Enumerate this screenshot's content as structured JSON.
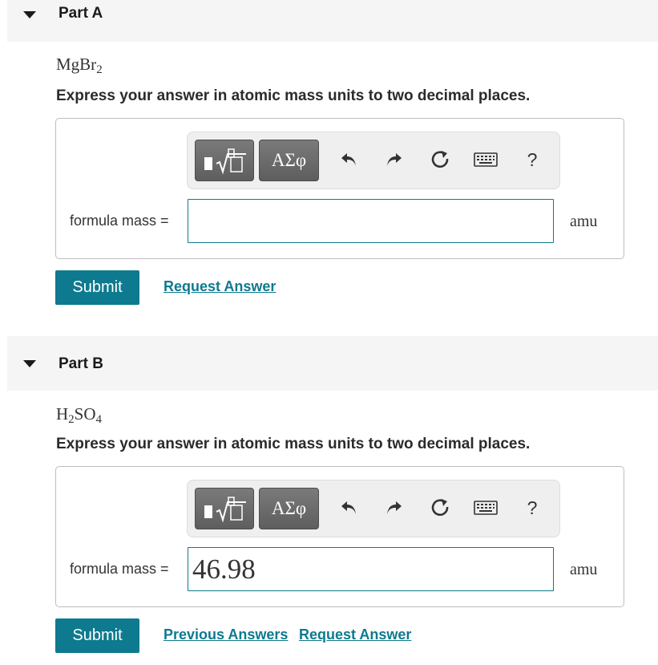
{
  "part_a": {
    "title": "Part A",
    "formula": {
      "base": "MgBr",
      "sub": "2"
    },
    "instruction": "Express your answer in atomic mass units to two decimal places.",
    "toolbar": {
      "templates_icon": "templates-sqrt-icon",
      "greek_label": "ΑΣφ",
      "undo_icon": "undo-icon",
      "redo_icon": "redo-icon",
      "reset_icon": "reset-icon",
      "keyboard_icon": "keyboard-icon",
      "help_label": "?"
    },
    "answer_label": "formula mass =",
    "answer_value": "",
    "unit": "amu",
    "submit_label": "Submit",
    "request_answer_label": "Request Answer"
  },
  "part_b": {
    "title": "Part B",
    "formula": {
      "p1": "H",
      "s1": "2",
      "p2": "SO",
      "s2": "4"
    },
    "instruction": "Express your answer in atomic mass units to two decimal places.",
    "toolbar": {
      "templates_icon": "templates-sqrt-icon",
      "greek_label": "ΑΣφ",
      "undo_icon": "undo-icon",
      "redo_icon": "redo-icon",
      "reset_icon": "reset-icon",
      "keyboard_icon": "keyboard-icon",
      "help_label": "?"
    },
    "answer_label": "formula mass =",
    "answer_value": "46.98",
    "unit": "amu",
    "submit_label": "Submit",
    "previous_answers_label": "Previous Answers",
    "request_answer_label": "Request Answer"
  },
  "colors": {
    "accent": "#0e7a8f",
    "header_bg": "#f5f5f5",
    "toolbar_button": "#666666"
  }
}
